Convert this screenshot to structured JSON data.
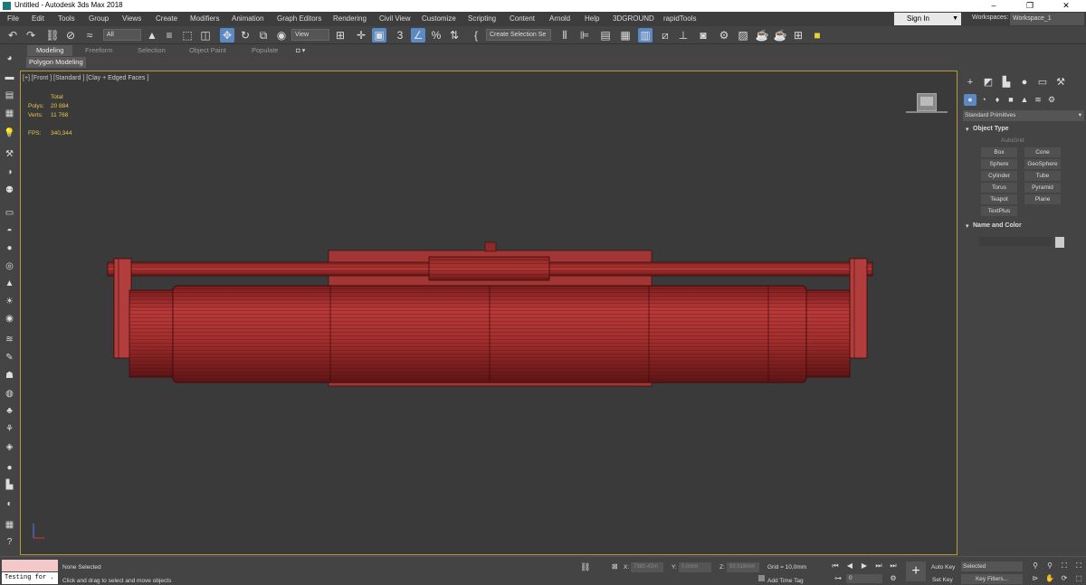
{
  "window": {
    "title": "Untitled - Autodesk 3ds Max 2018",
    "controls": [
      "–",
      "❐",
      "✕"
    ]
  },
  "menu": {
    "items": [
      "File",
      "Edit",
      "Tools",
      "Group",
      "Views",
      "Create",
      "Modifiers",
      "Animation",
      "Graph Editors",
      "Rendering",
      "Civil View",
      "Customize",
      "Scripting",
      "Content",
      "Arnold",
      "Help",
      "3DGROUND",
      "rapidTools"
    ],
    "sign_in": "Sign In",
    "workspaces_label": "Workspaces:",
    "workspace_value": "Workspace_1"
  },
  "toolbar": {
    "selection_filter": "All",
    "ref_coord": "View",
    "selection_set": "Create Selection Se"
  },
  "ribbon": {
    "tabs": [
      "Modeling",
      "Freeform",
      "Selection",
      "Object Paint",
      "Populate"
    ],
    "active_tab": "Modeling",
    "panel_label": "Polygon Modeling"
  },
  "viewport": {
    "label": "[+] [Front ] [Standard ] [Clay + Edged Faces ]",
    "stats": {
      "total_label": "Total",
      "polys_label": "Polys:",
      "polys_value": "20 884",
      "verts_label": "Verts:",
      "verts_value": "11 768",
      "fps_label": "FPS:",
      "fps_value": "340,344"
    },
    "model_color": "#a8302f"
  },
  "command_panel": {
    "category": "Standard Primitives",
    "object_type_title": "Object Type",
    "autogrid": "AutoGrid",
    "buttons": [
      "Box",
      "Cone",
      "Sphere",
      "GeoSphere",
      "Cylinder",
      "Tube",
      "Torus",
      "Pyramid",
      "Teapot",
      "Plane",
      "TextPlus"
    ],
    "name_color_title": "Name and Color"
  },
  "status": {
    "testing": "Testing for .",
    "selection": "None Selected",
    "prompt": "Click and drag to select and move objects",
    "x_label": "X:",
    "x_value": "7380,43m",
    "y_label": "Y:",
    "y_value": "0,0mm",
    "z_label": "Z:",
    "z_value": "93,516mm",
    "grid": "Grid = 10,0mm",
    "add_time_tag": "Add Time Tag",
    "frame_value": "0",
    "auto_key": "Auto Key",
    "auto_key_value": "Selected",
    "set_key": "Set Key",
    "key_filters": "Key Filters..."
  }
}
